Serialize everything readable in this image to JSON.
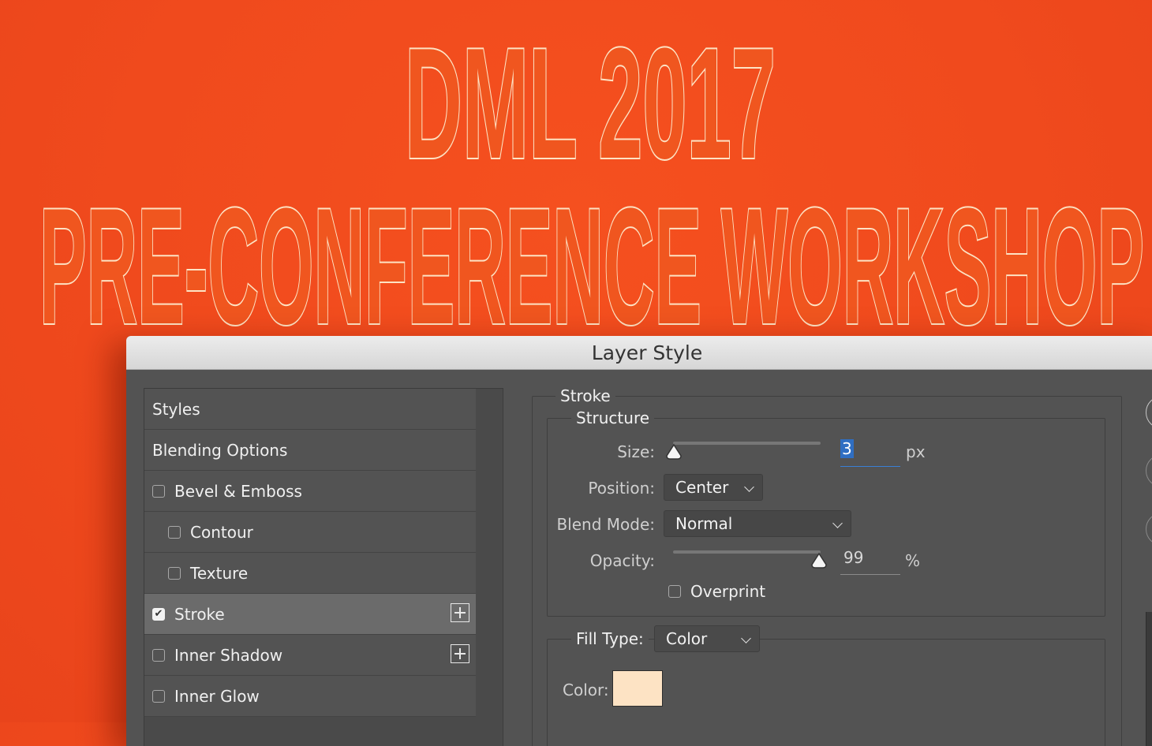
{
  "banner": {
    "line1": "DML 2017",
    "line2": "PRE-CONFERENCE WORKSHOP"
  },
  "dialog": {
    "title": "Layer Style",
    "list": [
      {
        "label": "Styles",
        "has_checkbox": false,
        "checked": false,
        "indent": 0,
        "has_add": false,
        "selected": false
      },
      {
        "label": "Blending Options",
        "has_checkbox": false,
        "checked": false,
        "indent": 0,
        "has_add": false,
        "selected": false
      },
      {
        "label": "Bevel & Emboss",
        "has_checkbox": true,
        "checked": false,
        "indent": 0,
        "has_add": false,
        "selected": false
      },
      {
        "label": "Contour",
        "has_checkbox": true,
        "checked": false,
        "indent": 1,
        "has_add": false,
        "selected": false
      },
      {
        "label": "Texture",
        "has_checkbox": true,
        "checked": false,
        "indent": 1,
        "has_add": false,
        "selected": false
      },
      {
        "label": "Stroke",
        "has_checkbox": true,
        "checked": true,
        "indent": 0,
        "has_add": true,
        "selected": true
      },
      {
        "label": "Inner Shadow",
        "has_checkbox": true,
        "checked": false,
        "indent": 0,
        "has_add": true,
        "selected": false
      },
      {
        "label": "Inner Glow",
        "has_checkbox": true,
        "checked": false,
        "indent": 0,
        "has_add": false,
        "selected": false
      }
    ],
    "stroke": {
      "section_title": "Stroke",
      "structure_title": "Structure",
      "size_label": "Size:",
      "size_value": "3",
      "size_unit": "px",
      "position_label": "Position:",
      "position_value": "Center",
      "blend_mode_label": "Blend Mode:",
      "blend_mode_value": "Normal",
      "opacity_label": "Opacity:",
      "opacity_value": "99",
      "opacity_unit": "%",
      "opacity_level": 0.99,
      "overprint_label": "Overprint",
      "overprint_checked": false,
      "fill_type_label": "Fill Type:",
      "fill_type_value": "Color",
      "color_label": "Color:",
      "color_value": "#fde3c4"
    }
  },
  "colors": {
    "background": "#f04a1d",
    "text_fill": "#f0561f",
    "text_stroke": "#fde3c4",
    "panel": "#535353",
    "selection": "#2f6ec2"
  }
}
